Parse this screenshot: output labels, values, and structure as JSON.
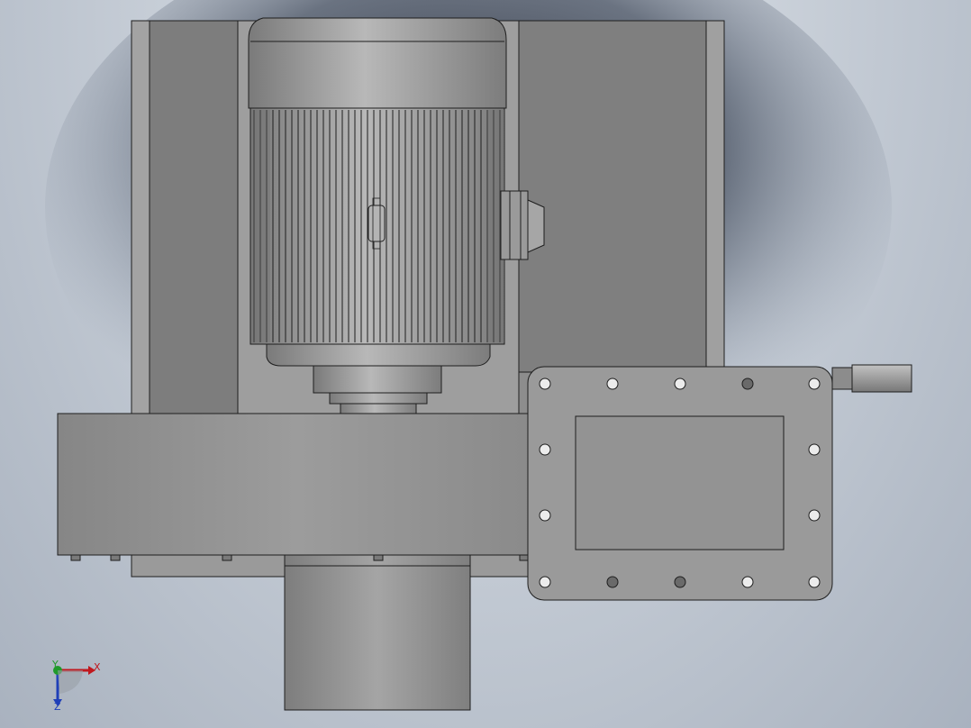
{
  "viewport": {
    "background_top": "#e8ecf2",
    "background_bottom": "#a9b2bf"
  },
  "model": {
    "description_icon": "cad-blower-motor-assembly",
    "shade_light": "#a8a8a8",
    "shade_mid": "#8e8e8e",
    "shade_dark": "#6f6f6f",
    "edge_color": "#1e1e1e"
  },
  "triad": {
    "x_label": "X",
    "y_label": "Y",
    "z_label": "Z",
    "x_color": "#c0181e",
    "y_color": "#1f9a2a",
    "z_color": "#1f3fb8"
  }
}
